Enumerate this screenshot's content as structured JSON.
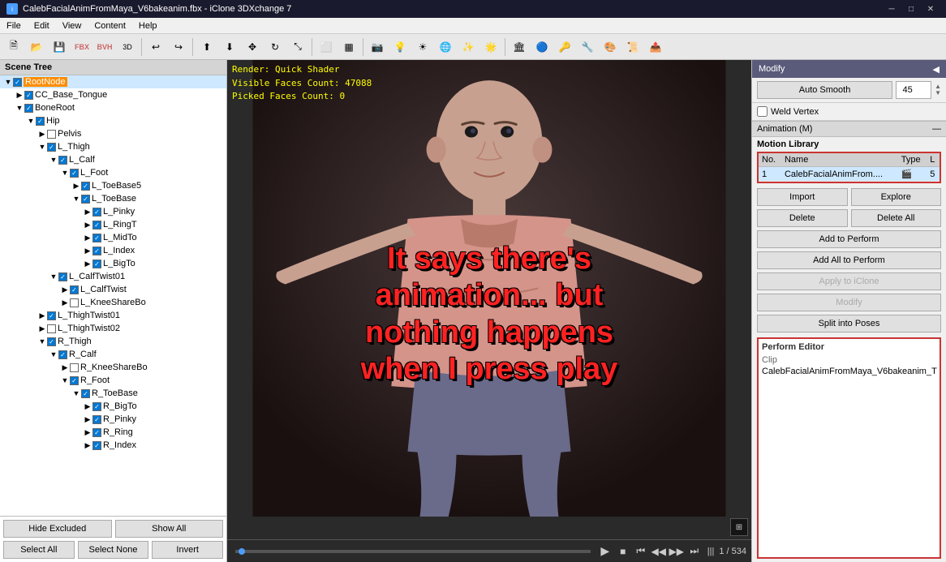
{
  "titleBar": {
    "title": "CalebFacialAnimFromMaya_V6bakeanim.fbx - iClone 3DXchange 7",
    "minBtn": "─",
    "maxBtn": "□",
    "closeBtn": "✕"
  },
  "menuBar": {
    "items": [
      "File",
      "Edit",
      "View",
      "Content",
      "Help"
    ]
  },
  "toolbar": {
    "buttons": [
      "📁",
      "💾",
      "🔧",
      "📦",
      "📷",
      "🔄",
      "↩",
      "↪",
      "⬆",
      "⬇",
      "✥",
      "↕",
      "↔",
      "⟲",
      "⬡",
      "▦",
      "📍",
      "🔲",
      "⬚",
      "🔻",
      "🔺",
      "☀",
      "🌑",
      "🏛",
      "🔵",
      "🔑",
      "🔨",
      "🎨",
      "📐"
    ]
  },
  "sceneTree": {
    "header": "Scene Tree",
    "nodes": [
      {
        "id": "root",
        "label": "RootNode",
        "level": 0,
        "expanded": true,
        "checked": true,
        "highlighted": true
      },
      {
        "id": "tongue",
        "label": "CC_Base_Tongue",
        "level": 1,
        "expanded": false,
        "checked": true,
        "highlighted": false
      },
      {
        "id": "boneroot",
        "label": "BoneRoot",
        "level": 1,
        "expanded": true,
        "checked": true,
        "highlighted": false
      },
      {
        "id": "hip",
        "label": "Hip",
        "level": 2,
        "expanded": true,
        "checked": true,
        "highlighted": false
      },
      {
        "id": "pelvis",
        "label": "Pelvis",
        "level": 3,
        "expanded": false,
        "checked": false,
        "highlighted": false
      },
      {
        "id": "lthigh",
        "label": "L_Thigh",
        "level": 3,
        "expanded": true,
        "checked": true,
        "highlighted": false
      },
      {
        "id": "lcalf",
        "label": "L_Calf",
        "level": 4,
        "expanded": true,
        "checked": true,
        "highlighted": false
      },
      {
        "id": "lfoot",
        "label": "L_Foot",
        "level": 5,
        "expanded": true,
        "checked": true,
        "highlighted": false
      },
      {
        "id": "ltoebase1",
        "label": "L_ToeBase5",
        "level": 6,
        "expanded": false,
        "checked": true,
        "highlighted": false
      },
      {
        "id": "ltoebase",
        "label": "L_ToeBase",
        "level": 6,
        "expanded": true,
        "checked": true,
        "highlighted": false
      },
      {
        "id": "lpinky",
        "label": "L_Pinky",
        "level": 7,
        "expanded": false,
        "checked": true,
        "highlighted": false
      },
      {
        "id": "lring",
        "label": "L_RingT",
        "level": 7,
        "expanded": false,
        "checked": true,
        "highlighted": false
      },
      {
        "id": "lmid",
        "label": "L_MidTo",
        "level": 7,
        "expanded": false,
        "checked": true,
        "highlighted": false
      },
      {
        "id": "lindex",
        "label": "L_Index",
        "level": 7,
        "expanded": false,
        "checked": true,
        "highlighted": false
      },
      {
        "id": "lbig",
        "label": "L_BigTo",
        "level": 7,
        "expanded": false,
        "checked": true,
        "highlighted": false
      },
      {
        "id": "lcalftwist",
        "label": "L_CalfTwist01",
        "level": 4,
        "expanded": true,
        "checked": true,
        "highlighted": false
      },
      {
        "id": "lcalftwist0",
        "label": "L_CalfTwist",
        "level": 5,
        "expanded": false,
        "checked": true,
        "highlighted": false
      },
      {
        "id": "lkneeshare",
        "label": "L_KneeShareBo",
        "level": 5,
        "expanded": false,
        "checked": false,
        "highlighted": false
      },
      {
        "id": "lthightwist",
        "label": "L_ThighTwist01",
        "level": 3,
        "expanded": false,
        "checked": true,
        "highlighted": false
      },
      {
        "id": "lthightwist2",
        "label": "L_ThighTwist02",
        "level": 3,
        "expanded": false,
        "checked": false,
        "highlighted": false
      },
      {
        "id": "rthigh",
        "label": "R_Thigh",
        "level": 3,
        "expanded": true,
        "checked": true,
        "highlighted": false
      },
      {
        "id": "rcalf",
        "label": "R_Calf",
        "level": 4,
        "expanded": true,
        "checked": true,
        "highlighted": false
      },
      {
        "id": "rkneeshare",
        "label": "R_KneeShareBo",
        "level": 5,
        "expanded": false,
        "checked": false,
        "highlighted": false
      },
      {
        "id": "rfoot",
        "label": "R_Foot",
        "level": 5,
        "expanded": true,
        "checked": true,
        "highlighted": false
      },
      {
        "id": "rtoebase",
        "label": "R_ToeBase",
        "level": 6,
        "expanded": true,
        "checked": true,
        "highlighted": false
      },
      {
        "id": "rbig",
        "label": "R_BigTo",
        "level": 7,
        "expanded": false,
        "checked": true,
        "highlighted": false
      },
      {
        "id": "rpinky",
        "label": "R_Pinky",
        "level": 7,
        "expanded": false,
        "checked": true,
        "highlighted": false
      },
      {
        "id": "rring",
        "label": "R_Ring",
        "level": 7,
        "expanded": false,
        "checked": true,
        "highlighted": false
      },
      {
        "id": "rindex",
        "label": "R_Index",
        "level": 7,
        "expanded": false,
        "checked": true,
        "highlighted": false
      }
    ],
    "hideExcludedBtn": "Hide Excluded",
    "showAllBtn": "Show All",
    "selectAllBtn": "Select All",
    "selectNoneBtn": "Select None",
    "invertBtn": "Invert"
  },
  "viewport": {
    "renderInfo": "Render: Quick Shader",
    "visibleFaces": "Visible Faces Count: 47088",
    "pickedFaces": "Picked Faces Count: 0",
    "overlayText": "It says there's\nanimation... but\nnothing happens\nwhen I press play",
    "playback": {
      "current": "1",
      "total": "534",
      "separator": "/"
    }
  },
  "rightPanel": {
    "title": "Modify",
    "autoSmoothBtn": "Auto Smooth",
    "autoSmoothValue": "45",
    "weldVertexLabel": "Weld Vertex",
    "animationSection": "Animation (M)",
    "motionLibraryLabel": "Motion Library",
    "motionTable": {
      "headers": [
        "No.",
        "Name",
        "Type",
        "L"
      ],
      "rows": [
        {
          "no": "1",
          "name": "CalebFacialAnimFrom....",
          "type": "🎬",
          "length": "5"
        }
      ]
    },
    "importBtn": "Import",
    "exploreBtn": "Explore",
    "deleteBtn": "Delete",
    "deleteAllBtn": "Delete All",
    "addToPerformBtn": "Add to Perform",
    "addAllToPerformBtn": "Add All to Perform",
    "applyToICloneBtn": "Apply to iClone",
    "modifyBtn": "Modify",
    "splitIntoPosesBtn": "Split into Poses",
    "performEditor": {
      "header": "Perform Editor",
      "clipLabel": "Clip",
      "clipValue": "CalebFacialAnimFromMaya_V6bakeanim_T"
    }
  }
}
